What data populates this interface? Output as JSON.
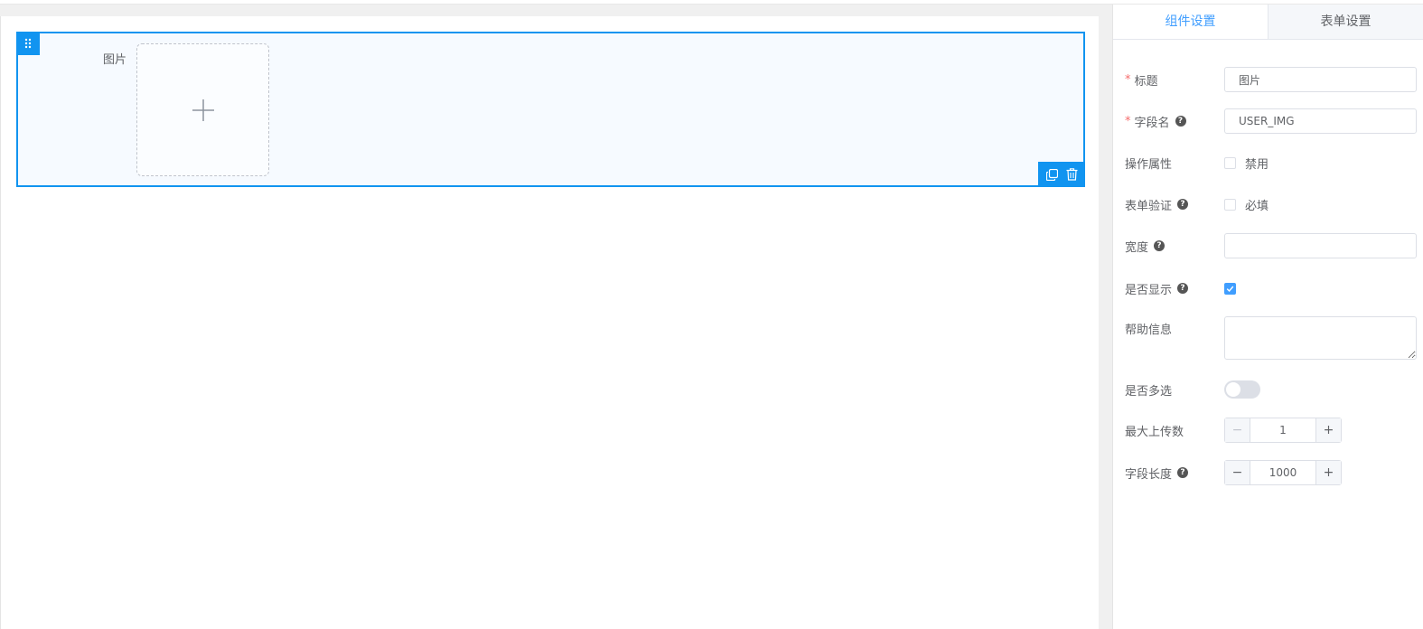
{
  "canvas": {
    "widget": {
      "label": "图片",
      "upload_icon": "plus-icon",
      "drag_icon": "drag-handle-icon",
      "copy_icon": "copy-icon",
      "delete_icon": "trash-icon"
    }
  },
  "panel": {
    "tabs": [
      {
        "label": "组件设置",
        "active": true
      },
      {
        "label": "表单设置",
        "active": false
      }
    ],
    "fields": {
      "title": {
        "label": "标题",
        "required": true,
        "value": "图片"
      },
      "field_name": {
        "label": "字段名",
        "required": true,
        "value": "USER_IMG",
        "help": "?"
      },
      "operation": {
        "label": "操作属性",
        "option": "禁用",
        "checked": false
      },
      "validation": {
        "label": "表单验证",
        "option": "必填",
        "checked": false,
        "help": "?"
      },
      "width": {
        "label": "宽度",
        "value": "",
        "help": "?"
      },
      "visible": {
        "label": "是否显示",
        "checked": true,
        "help": "?"
      },
      "help_info": {
        "label": "帮助信息",
        "value": ""
      },
      "multiple": {
        "label": "是否多选",
        "on": false
      },
      "max_upload": {
        "label": "最大上传数",
        "value": "1",
        "minus": "−",
        "plus": "+"
      },
      "field_length": {
        "label": "字段长度",
        "value": "1000",
        "minus": "−",
        "plus": "+",
        "help": "?"
      }
    }
  },
  "colors": {
    "accent": "#1194f0",
    "tab_active": "#409eff",
    "required": "#f56c6c"
  }
}
